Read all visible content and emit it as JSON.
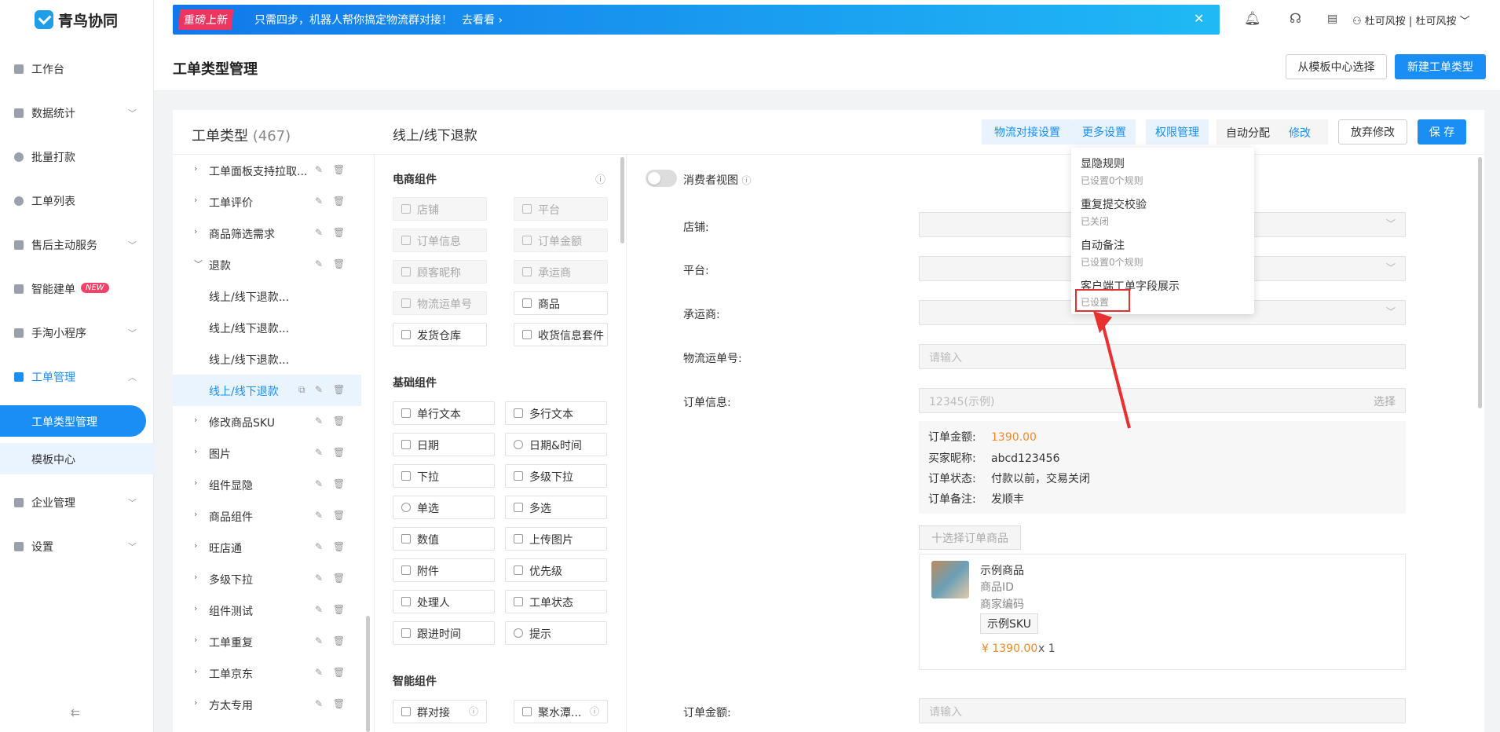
{
  "app": {
    "name": "青鸟协同"
  },
  "banner": {
    "tag": "重磅上新",
    "text": "只需四步，机器人帮你搞定物流群对接！",
    "link": "去看看"
  },
  "user": {
    "name": "杜可风按 | 杜可风按"
  },
  "sidebar": {
    "items": [
      {
        "label": "工作台"
      },
      {
        "label": "数据统计"
      },
      {
        "label": "批量打款"
      },
      {
        "label": "工单列表"
      },
      {
        "label": "售后主动服务"
      },
      {
        "label": "智能建单",
        "badge": "NEW"
      },
      {
        "label": "手淘小程序"
      },
      {
        "label": "工单管理"
      },
      {
        "label": "企业管理"
      },
      {
        "label": "设置"
      }
    ],
    "sub_items": [
      {
        "label": "工单类型管理"
      },
      {
        "label": "模板中心"
      }
    ]
  },
  "header": {
    "title": "工单类型管理",
    "template_btn": "从模板中心选择",
    "new_btn": "新建工单类型"
  },
  "types_panel": {
    "title": "工单类型",
    "count": "(467)"
  },
  "tree": [
    {
      "label": "工单面板支持拉取..."
    },
    {
      "label": "工单评价"
    },
    {
      "label": "商品筛选需求"
    },
    {
      "label": "退款"
    },
    {
      "label": "线上/线下退款..."
    },
    {
      "label": "线上/线下退款..."
    },
    {
      "label": "线上/线下退款..."
    },
    {
      "label": "线上/线下退款"
    },
    {
      "label": "修改商品SKU"
    },
    {
      "label": "图片"
    },
    {
      "label": "组件显隐"
    },
    {
      "label": "商品组件"
    },
    {
      "label": "旺店通"
    },
    {
      "label": "多级下拉"
    },
    {
      "label": "组件测试"
    },
    {
      "label": "工单重复"
    },
    {
      "label": "工单京东"
    },
    {
      "label": "方太专用"
    }
  ],
  "form_title": "线上/线下退款",
  "toolbar": {
    "logistics": "物流对接设置",
    "more": "更多设置",
    "perm": "权限管理",
    "auto_assign": "自动分配",
    "modify": "修改",
    "discard": "放弃修改",
    "save": "保 存"
  },
  "components": {
    "ecommerce_title": "电商组件",
    "ecommerce": [
      "店铺",
      "平台",
      "订单信息",
      "订单金额",
      "顾客昵称",
      "承运商",
      "物流运单号",
      "商品",
      "发货仓库",
      "收货信息套件"
    ],
    "basic_title": "基础组件",
    "basic": [
      "单行文本",
      "多行文本",
      "日期",
      "日期&时间",
      "下拉",
      "多级下拉",
      "单选",
      "多选",
      "数值",
      "上传图片",
      "附件",
      "优先级",
      "处理人",
      "工单状态",
      "跟进时间",
      "提示"
    ],
    "smart_title": "智能组件",
    "smart": [
      "群对接",
      "聚水潭..."
    ]
  },
  "form": {
    "consumer_view": "消费者视图",
    "labels": {
      "shop": "店铺:",
      "platform": "平台:",
      "carrier": "承运商:",
      "tracking": "物流运单号:",
      "order_info": "订单信息:",
      "order_amount": "订单金额:"
    },
    "placeholder_input": "请输入",
    "order_example": "12345(示例)",
    "select_text": "选择",
    "order_rows": [
      {
        "k": "订单金额:",
        "v": "1390.00"
      },
      {
        "k": "买家昵称:",
        "v": "abcd123456"
      },
      {
        "k": "订单状态:",
        "v": "付款以前，交易关闭"
      },
      {
        "k": "订单备注:",
        "v": "发顺丰"
      }
    ],
    "choose_goods": "十选择订单商品",
    "product": {
      "name": "示例商品",
      "id": "商品ID",
      "code": "商家编码",
      "sku": "示例SKU",
      "price": "¥ 1390.00",
      "qty": "x 1"
    }
  },
  "dropdown": [
    {
      "title": "显隐规则",
      "sub": "已设置0个规则"
    },
    {
      "title": "重复提交校验",
      "sub": "已关闭"
    },
    {
      "title": "自动备注",
      "sub": "已设置0个规则"
    },
    {
      "title": "客户端工单字段展示",
      "sub": "已设置"
    }
  ],
  "colors": {
    "accent": "#1a8ef5",
    "money": "#f08a24",
    "highlight": "#e73030"
  }
}
